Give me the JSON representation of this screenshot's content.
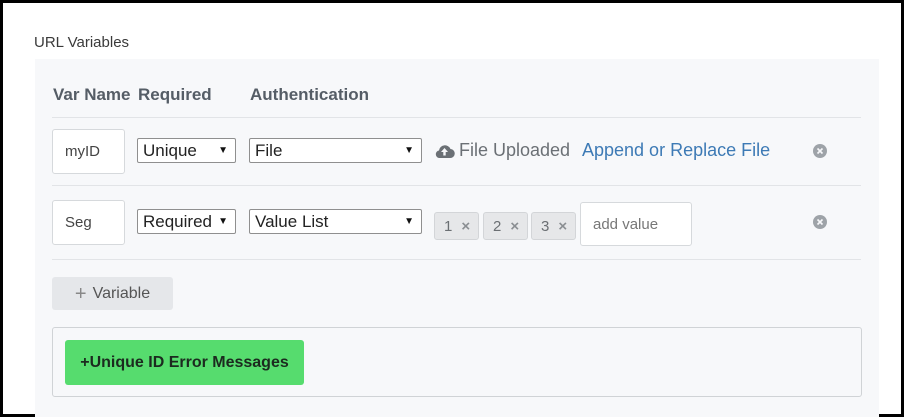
{
  "section": {
    "title": "URL Variables"
  },
  "table": {
    "headers": {
      "var_name": "Var Name",
      "required": "Required",
      "authentication": "Authentication"
    },
    "rows": [
      {
        "var_name": "myID",
        "required": "Unique",
        "authentication": "File",
        "status_text": "File Uploaded",
        "status_icon": "cloud-upload-icon",
        "link_text": "Append or Replace File"
      },
      {
        "var_name": "Seg",
        "required": "Required",
        "authentication": "Value List",
        "values": [
          "1",
          "2",
          "3"
        ],
        "add_value_placeholder": "add value"
      }
    ]
  },
  "add_variable": {
    "label": "Variable"
  },
  "error_messages": {
    "label": "+Unique ID Error Messages",
    "color": "#56dc6e"
  },
  "colors": {
    "link": "#3d7ab5",
    "header": "#555d66"
  }
}
